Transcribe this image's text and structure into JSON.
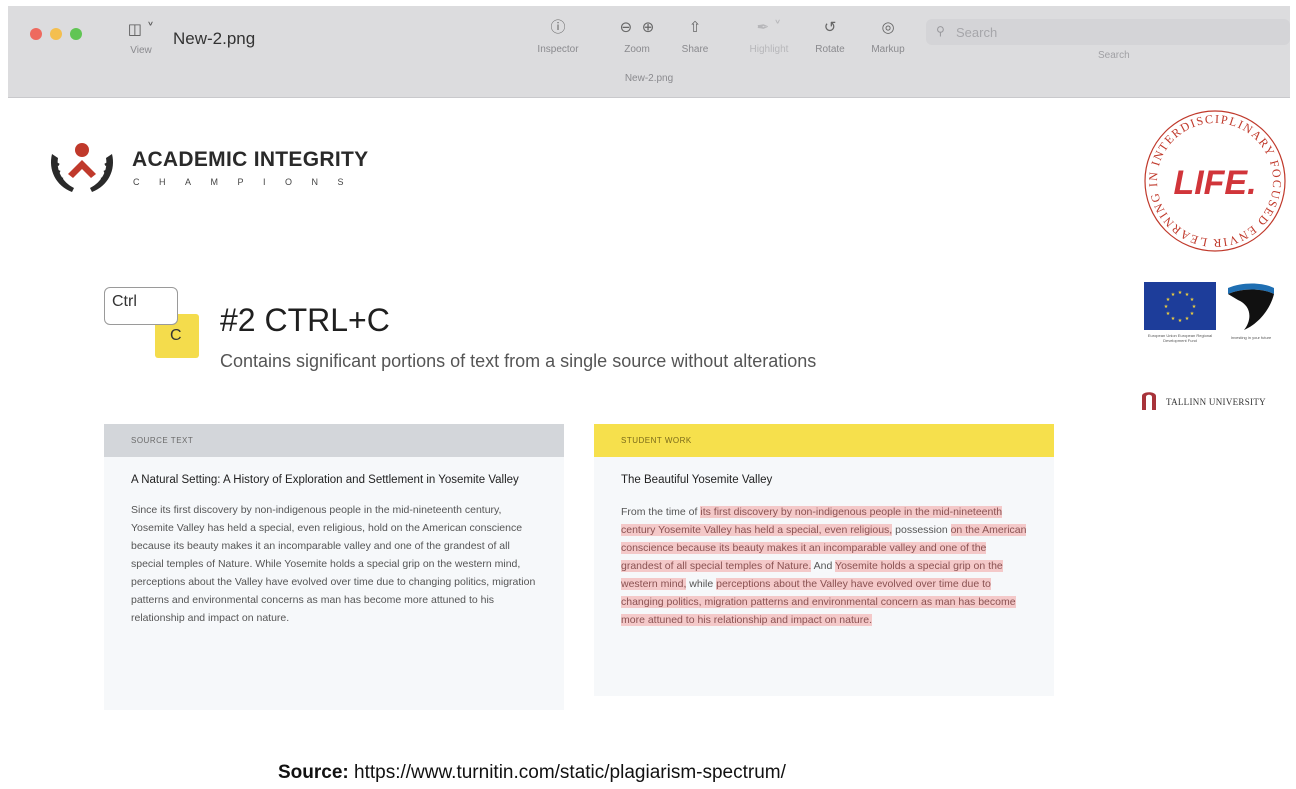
{
  "window": {
    "filename": "New-2.png",
    "subtitle": "New-2.png",
    "view_label": "View",
    "toolbar": {
      "inspector": "Inspector",
      "zoom": "Zoom",
      "share": "Share",
      "highlight": "Highlight",
      "rotate": "Rotate",
      "markup": "Markup"
    },
    "search": {
      "placeholder": "Search",
      "label": "Search"
    }
  },
  "icons": {
    "view": "sidebar-icon",
    "inspector": "info-icon",
    "zoom_out": "zoom-out-icon",
    "zoom_in": "zoom-in-icon",
    "share": "share-icon",
    "highlight": "highlighter-icon",
    "rotate": "rotate-icon",
    "markup": "markup-icon",
    "search": "search-icon"
  },
  "colors": {
    "accent_yellow": "#f6e04c",
    "source_header": "#d3d6da",
    "highlight_pink": "#f4c9c9",
    "logo_red": "#c0392b",
    "eu_blue": "#1d3d9a"
  },
  "page": {
    "logo": {
      "title": "ACADEMIC INTEGRITY",
      "subtitle": "CHAMPIONS"
    },
    "life_seal": {
      "ring_text": "LEARNING IN INTERDISCIPLINARY FOCUSED ENVIRONMENT",
      "center": "LIFE."
    },
    "eu_caption": "European Union European Regional Development Fund",
    "estonia_caption": "Investing in your future",
    "tallinn": "TALLINN UNIVERSITY",
    "keys": {
      "ctrl": "Ctrl",
      "c": "C"
    },
    "heading": "#2 CTRL+C",
    "subheading": "Contains significant portions of text from a single source without alterations",
    "source_text": {
      "header": "SOURCE TEXT",
      "title": "A Natural Setting: A History of Exploration and Settlement in Yosemite Valley",
      "body": "Since its first discovery by non-indigenous people in the mid-nineteenth century, Yosemite Valley has held a special, even religious, hold on the American conscience because its beauty makes it an incomparable valley and one of the grandest of all special temples of Nature. While Yosemite holds a special grip on the western mind, perceptions about the Valley have evolved over time due to changing politics, migration patterns and environmental concerns as man has become more attuned to his relationship and impact on nature."
    },
    "student_work": {
      "header": "STUDENT WORK",
      "title": "The Beautiful Yosemite Valley",
      "segments": [
        {
          "text": "From the time of ",
          "hl": false
        },
        {
          "text": "its first discovery by non-indigenous people in the mid-nineteenth century Yosemite Valley has held a special, even religious,",
          "hl": true
        },
        {
          "text": " possession ",
          "hl": false
        },
        {
          "text": "on the American conscience because its beauty makes it an incomparable valley and one of the grandest of all special temples of Nature.",
          "hl": true
        },
        {
          "text": " And ",
          "hl": false
        },
        {
          "text": "Yosemite holds a special grip on the western mind,",
          "hl": true
        },
        {
          "text": " while ",
          "hl": false
        },
        {
          "text": "perceptions about the Valley have evolved over time due to changing politics, migration patterns and environmental concern as man has become more attuned to his relationship and impact on nature.",
          "hl": true
        }
      ]
    },
    "source_line": {
      "label": "Source:",
      "url": "https://www.turnitin.com/static/plagiarism-spectrum/"
    }
  }
}
